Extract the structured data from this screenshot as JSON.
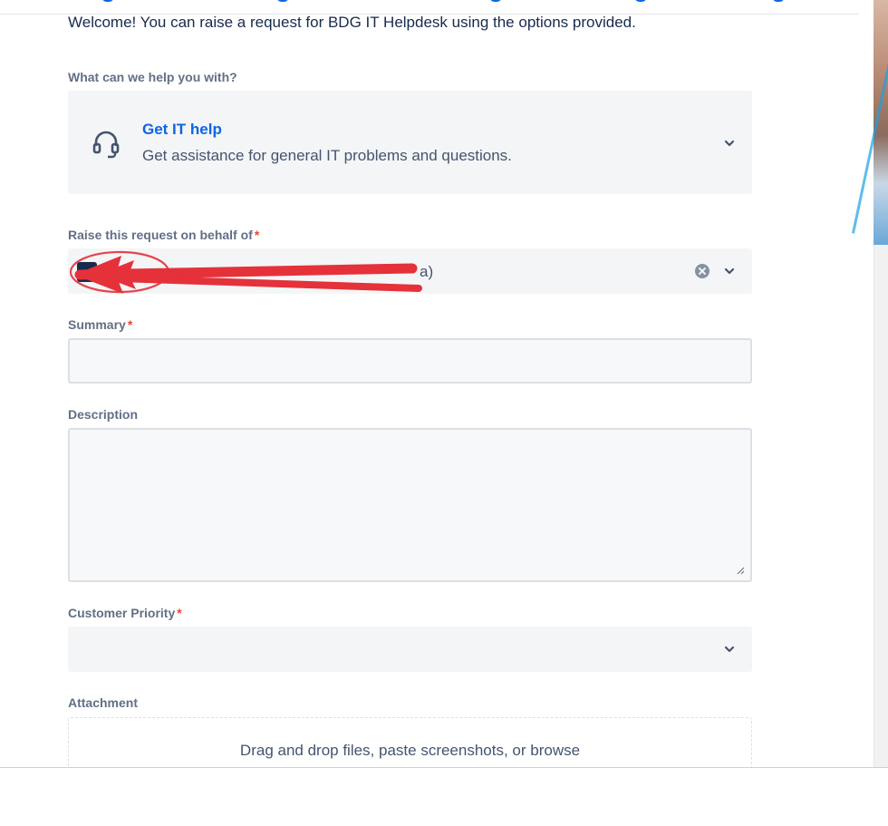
{
  "form": {
    "welcome": "Welcome! You can raise a request for BDG IT Helpdesk using the options provided.",
    "help_label": "What can we help you with?",
    "request_type": {
      "title": "Get IT help",
      "description": "Get assistance for general IT problems and questions."
    },
    "behalf_label": "Raise this request on behalf of",
    "behalf_value": "a)",
    "summary_label": "Summary",
    "summary_value": "",
    "description_label": "Description",
    "description_value": "",
    "priority_label": "Customer Priority",
    "priority_value": "",
    "attachment_label": "Attachment",
    "attachment_hint": "Drag and drop files, paste screenshots, or browse",
    "required_mark": "*"
  },
  "colors": {
    "accent_link": "#0c66e4",
    "required": "#e34935",
    "annotation": "#e5313a",
    "field_bg": "#f4f5f7"
  },
  "icons": {
    "request_type": "headset-icon",
    "expand": "chevron-down-icon",
    "clear": "clear-icon",
    "annotation": "red-arrow-annotation"
  }
}
